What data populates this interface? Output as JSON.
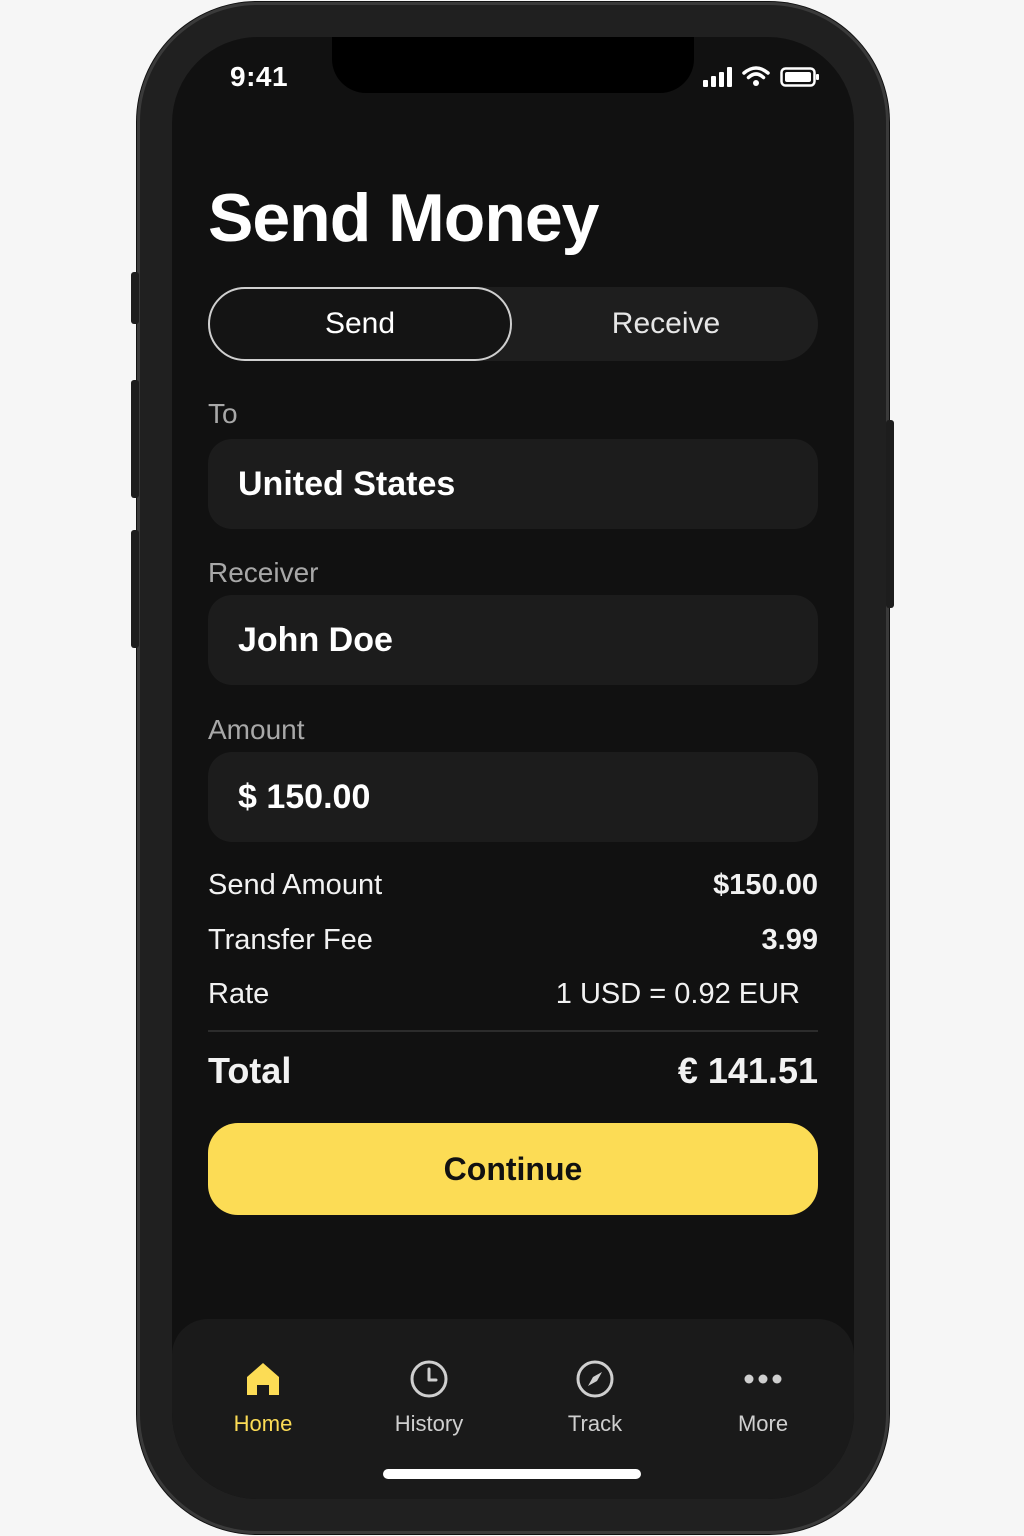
{
  "status_bar": {
    "time": "9:41"
  },
  "page_title": "Send Money",
  "segmented": {
    "send_label": "Send",
    "receive_label": "Receive",
    "selected": "Send"
  },
  "form": {
    "to_label": "To",
    "to_value": "United States",
    "receiver_label": "Receiver",
    "receiver_value": "John Doe",
    "amount_label": "Amount",
    "amount_value": "$ 150.00"
  },
  "summary": {
    "send_amount_label": "Send Amount",
    "send_amount_value": "$150.00",
    "fee_label": "Transfer Fee",
    "fee_value": "3.99",
    "rate_label": "Rate",
    "rate_value": "1 USD = 0.92 EUR",
    "total_label": "Total",
    "total_value": "€ 141.51"
  },
  "continue_label": "Continue",
  "tabbar": {
    "items": [
      {
        "label": "Home",
        "icon": "home-icon",
        "active": true
      },
      {
        "label": "History",
        "icon": "clock-icon",
        "active": false
      },
      {
        "label": "Track",
        "icon": "compass-icon",
        "active": false
      },
      {
        "label": "More",
        "icon": "more-dots-icon",
        "active": false
      }
    ]
  },
  "colors": {
    "accent": "#fcdc55",
    "background": "#111111",
    "field": "#1c1c1c"
  }
}
